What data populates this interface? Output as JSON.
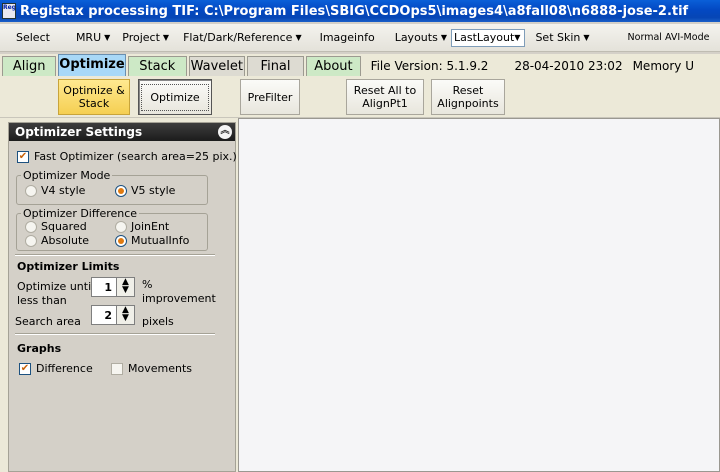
{
  "window": {
    "title": "Registax processing TIF: C:\\Program Files\\SBIG\\CCDOps5\\images4\\a8fall08\\n6888-jose-2.tif",
    "app_icon_text": "Regi Stax"
  },
  "menu": {
    "select": "Select",
    "mru": "MRU",
    "project": "Project",
    "flat_dark_reference": "Flat/Dark/Reference",
    "imageinfo": "Imageinfo",
    "layouts": "Layouts",
    "layout_value": "LastLayout",
    "set_skin": "Set Skin",
    "avi_mode": "Normal AVI-Mode"
  },
  "tabs": [
    {
      "label": "Align",
      "active": false
    },
    {
      "label": "Optimize",
      "active": true
    },
    {
      "label": "Stack",
      "active": false
    },
    {
      "label": "Wavelet",
      "active": false
    },
    {
      "label": "Final",
      "active": false
    },
    {
      "label": "About",
      "active": false
    }
  ],
  "file_info": {
    "version": "File Version: 5.1.9.2",
    "timestamp": "28-04-2010 23:02",
    "memory": "Memory U"
  },
  "toolbar": {
    "optimize_stack": "Optimize & Stack",
    "optimize": "Optimize",
    "prefilter": "PreFilter",
    "reset_all": "Reset All to AlignPt1",
    "reset_alignpoints": "Reset Alignpoints"
  },
  "optimizer": {
    "header": "Optimizer Settings",
    "fast_optimizer": "Fast Optimizer (search area=25 pix.)",
    "fast_optimizer_checked": true,
    "mode_title": "Optimizer Mode",
    "v4_style": "V4 style",
    "v5_style": "V5 style",
    "difference_title": "Optimizer Difference",
    "squared": "Squared",
    "joinent": "JoinEnt",
    "absolute": "Absolute",
    "mutualinfo": "MutualInfo",
    "limits_title": "Optimizer Limits",
    "optimize_until": "Optimize until",
    "less_than": "less than",
    "improvement_value": "1",
    "percent": "%",
    "improvement": "improvement",
    "search_area": "Search area",
    "search_value": "2",
    "pixels": "pixels",
    "graphs_title": "Graphs",
    "difference": "Difference",
    "difference_checked": true,
    "movements": "Movements",
    "movements_checked": false
  },
  "colors": {
    "title_blue": "#0348c2",
    "tab_active": "#a8d8f8",
    "tab_green": "#cde9c6",
    "button_yellow": "#f5cf52"
  }
}
